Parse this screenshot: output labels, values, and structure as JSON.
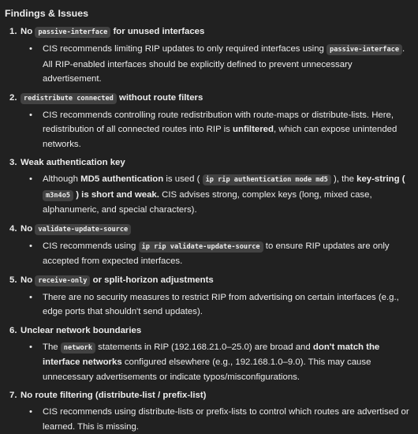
{
  "heading": "Findings & Issues",
  "items": [
    {
      "num": "1.",
      "title": [
        {
          "t": "text",
          "v": "No "
        },
        {
          "t": "code",
          "v": "passive-interface"
        },
        {
          "t": "text",
          "v": " for unused interfaces"
        }
      ],
      "bullets": [
        [
          {
            "t": "text",
            "v": "CIS recommends limiting RIP updates to only required interfaces using "
          },
          {
            "t": "code",
            "v": "passive-interface"
          },
          {
            "t": "text",
            "v": ". All RIP-enabled interfaces should be explicitly defined to prevent unnecessary advertisement."
          }
        ]
      ]
    },
    {
      "num": "2.",
      "title": [
        {
          "t": "code",
          "v": "redistribute connected"
        },
        {
          "t": "text",
          "v": " without route filters"
        }
      ],
      "bullets": [
        [
          {
            "t": "text",
            "v": "CIS recommends controlling route redistribution with route-maps or distribute-lists. Here, redistribution of all connected routes into RIP is "
          },
          {
            "t": "bold",
            "v": "unfiltered"
          },
          {
            "t": "text",
            "v": ", which can expose unintended networks."
          }
        ]
      ]
    },
    {
      "num": "3.",
      "title": [
        {
          "t": "text",
          "v": "Weak authentication key"
        }
      ],
      "bullets": [
        [
          {
            "t": "text",
            "v": "Although "
          },
          {
            "t": "bold",
            "v": "MD5 authentication"
          },
          {
            "t": "text",
            "v": " is used ( "
          },
          {
            "t": "code",
            "v": "ip rip authentication mode md5"
          },
          {
            "t": "text",
            "v": " ), the "
          },
          {
            "t": "bold",
            "v": "key-string ( "
          },
          {
            "t": "code",
            "v": "m3n4o5"
          },
          {
            "t": "bold",
            "v": " ) is short and weak."
          },
          {
            "t": "text",
            "v": " CIS advises strong, complex keys (long, mixed case, alphanumeric, and special characters)."
          }
        ]
      ]
    },
    {
      "num": "4.",
      "title": [
        {
          "t": "text",
          "v": "No "
        },
        {
          "t": "code",
          "v": "validate-update-source"
        }
      ],
      "bullets": [
        [
          {
            "t": "text",
            "v": "CIS recommends using "
          },
          {
            "t": "code",
            "v": "ip rip validate-update-source"
          },
          {
            "t": "text",
            "v": " to ensure RIP updates are only accepted from expected interfaces."
          }
        ]
      ]
    },
    {
      "num": "5.",
      "title": [
        {
          "t": "text",
          "v": "No "
        },
        {
          "t": "code",
          "v": "receive-only"
        },
        {
          "t": "text",
          "v": " or split-horizon adjustments"
        }
      ],
      "bullets": [
        [
          {
            "t": "text",
            "v": "There are no security measures to restrict RIP from advertising on certain interfaces (e.g., edge ports that shouldn't send updates)."
          }
        ]
      ]
    },
    {
      "num": "6.",
      "title": [
        {
          "t": "text",
          "v": "Unclear network boundaries"
        }
      ],
      "bullets": [
        [
          {
            "t": "text",
            "v": "The "
          },
          {
            "t": "code",
            "v": "network"
          },
          {
            "t": "text",
            "v": " statements in RIP (192.168.21.0–25.0) are broad and "
          },
          {
            "t": "bold",
            "v": "don't match the interface networks"
          },
          {
            "t": "text",
            "v": " configured elsewhere (e.g., 192.168.1.0–9.0). This may cause unnecessary advertisements or indicate typos/misconfigurations."
          }
        ]
      ]
    },
    {
      "num": "7.",
      "title": [
        {
          "t": "text",
          "v": "No route filtering (distribute-list / prefix-list)"
        }
      ],
      "bullets": [
        [
          {
            "t": "text",
            "v": "CIS recommends using distribute-lists or prefix-lists to control which routes are advertised or learned. This is missing."
          }
        ]
      ]
    }
  ]
}
